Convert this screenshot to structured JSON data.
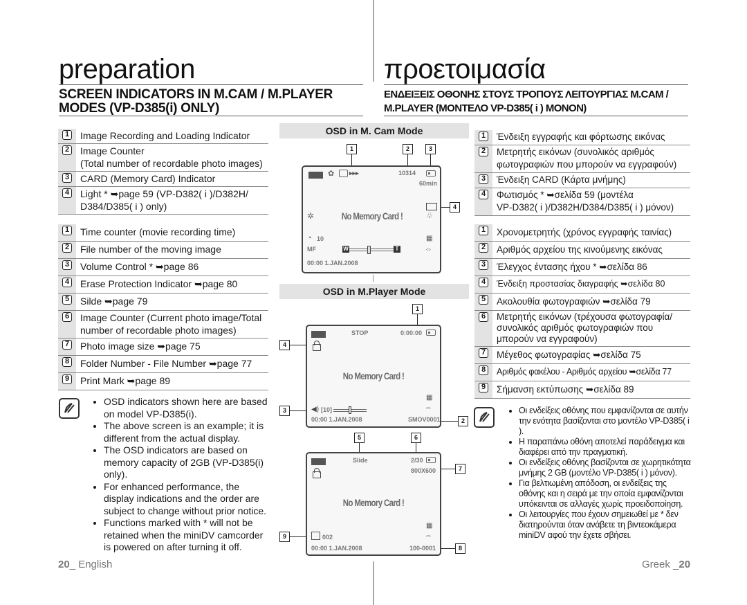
{
  "english": {
    "title": "preparation",
    "heading_line1": "SCREEN INDICATORS IN M.CAM / M.PLAYER",
    "heading_line2": "MODES (VP-D385(i) ONLY)",
    "mcam_items": [
      {
        "num": "1",
        "text": "Image Recording and Loading Indicator"
      },
      {
        "num": "2",
        "text": "Image Counter",
        "text2": "(Total number of recordable photo images)"
      },
      {
        "num": "3",
        "text": "CARD (Memory Card) Indicator"
      },
      {
        "num": "4",
        "text": "Light * ➥page 59 (VP-D382( i )/D382H/",
        "text2": "D384/D385( i ) only)"
      }
    ],
    "mplayer_items": [
      {
        "num": "1",
        "text": "Time counter (movie recording time)"
      },
      {
        "num": "2",
        "text": "File number of the moving image"
      },
      {
        "num": "3",
        "text": "Volume Control * ➥page 86"
      },
      {
        "num": "4",
        "text": " Erase Protection Indicator ➥page 80"
      },
      {
        "num": "5",
        "text": "Silde ➥page 79"
      },
      {
        "num": "6",
        "text": "Image Counter (Current photo image/Total",
        "text2": "number of recordable photo images)"
      },
      {
        "num": "7",
        "text": "Photo image size ➥page 75"
      },
      {
        "num": "8",
        "text": "Folder Number - File Number  ➥page 77"
      },
      {
        "num": "9",
        "text": "Print Mark ➥page 89"
      }
    ],
    "notes": [
      "OSD indicators shown here are based on model VP-D385(i).",
      "The above screen is an example; it is different from the actual display.",
      "The OSD indicators are based on memory capacity of 2GB (VP-D385(i) only).",
      "For enhanced performance, the display indications and the order are subject to change without prior notice.",
      "Functions marked with * will not be retained when the miniDV camcorder is powered on after turning it off."
    ],
    "footer_page": "20",
    "footer_lang": "_ English"
  },
  "greek": {
    "title": "προετοιμασία",
    "heading_line1": "ΕΝΔΕΙΞΕΙΣ ΟΘΟΝΗΣ ΣΤΟΥΣ ΤΡΟΠΟΥΣ ΛΕΙΤΟΥΡΓΙΑΣ M.CAM /",
    "heading_line2": "M.PLAYER (ΜΟΝΤΕΛΟ VP-D385( i ) ΜΟΝΟΝ)",
    "mcam_items": [
      {
        "num": "1",
        "text": "Ένδειξη εγγραφής και φόρτωσης εικόνας"
      },
      {
        "num": "2",
        "text": "Μετρητής εικόνων (συνολικός αριθμός",
        "text2": "φωτογραφιών που μπορούν να εγγραφούν)"
      },
      {
        "num": "3",
        "text": "Ένδειξη CARD (Κάρτα μνήμης)"
      },
      {
        "num": "4",
        "text": "Φωτισμός * ➥σελίδα  59 (μοντέλα",
        "text2": "VP-D382( i )/D382H/D384/D385( i ) μόνον)"
      }
    ],
    "mplayer_items": [
      {
        "num": "1",
        "text": "Χρονομετρητής (χρόνος εγγραφής ταινίας)"
      },
      {
        "num": "2",
        "text": "Αριθμός αρχείου της κινούμενης εικόνας"
      },
      {
        "num": "3",
        "text": "Έλεγχος έντασης ήχου *  ➥σελίδα  86"
      },
      {
        "num": "4",
        "text": "Ένδειξη προστασίας διαγραφής  ➥σελίδα  80"
      },
      {
        "num": "5",
        "text": "Ακολουθία φωτογραφιών  ➥σελίδα  79"
      },
      {
        "num": "6",
        "text": "Μετρητής εικόνων (τρέχουσα φωτογραφία/",
        "text2": "συνολικός αριθμός φωτογραφιών που",
        "text3": "μπορούν να εγγραφούν)"
      },
      {
        "num": "7",
        "text": "Μέγεθος φωτογραφίας ➥σελίδα  75"
      },
      {
        "num": "8",
        "text": "Αριθμός φακέλου - Αριθμός αρχείου ➥σελίδα 77"
      },
      {
        "num": "9",
        "text": "Σήμανση εκτύπωσης  ➥σελίδα  89"
      }
    ],
    "notes": [
      "Οι ενδείξεις οθόνης που εμφανίζονται σε αυτήν την ενότητα βασίζονται στο μοντέλο VP-D385( i ).",
      "Η παραπάνω οθόνη αποτελεί παράδειγμα και διαφέρει από την πραγματική.",
      "Οι ενδείξεις οθόνης βασίζονται σε χωρητικότητα μνήμης 2 GB (μοντέλο VP-D385( i ) μόνον).",
      "Για βελτιωμένη απόδοση, οι ενδείξεις της οθόνης και η σειρά με την οποία εμφανίζονται υπόκεινται σε αλλαγές χωρίς προειδοποίηση.",
      "Οι λειτουργίες που έχουν σημειωθεί με * δεν διατηρούνται όταν ανάβετε τη βιντεοκάμερα miniDV αφού την έχετε σβήσει."
    ],
    "footer_lang": "Greek _",
    "footer_page": "20"
  },
  "osd": {
    "mcam": {
      "header": "OSD in M. Cam Mode",
      "callouts": [
        "1",
        "2",
        "3",
        "4"
      ],
      "counter": "10314",
      "time_remaining": "60min",
      "message": "No Memory Card !",
      "self_timer": "10",
      "focus": "MF",
      "zoom_w": "W",
      "zoom_t": "T",
      "datetime": "00:00  1.JAN.2008"
    },
    "mplayer_movie": {
      "header": "OSD in M.Player Mode",
      "callouts": [
        "1",
        "2",
        "3",
        "4"
      ],
      "status": "STOP",
      "time_counter": "0:00:00",
      "message": "No Memory Card !",
      "volume": "[10]",
      "datetime": "00:00  1.JAN.2008",
      "file_number": "SMOV0001"
    },
    "mplayer_photo": {
      "callouts": [
        "5",
        "6",
        "7",
        "8",
        "9"
      ],
      "status": "Slide",
      "image_counter": "2/30",
      "image_size": "800X600",
      "message": "No Memory Card !",
      "print_count": "002",
      "datetime": "00:00  1.JAN.2008",
      "folder_file": "100-0001"
    }
  }
}
